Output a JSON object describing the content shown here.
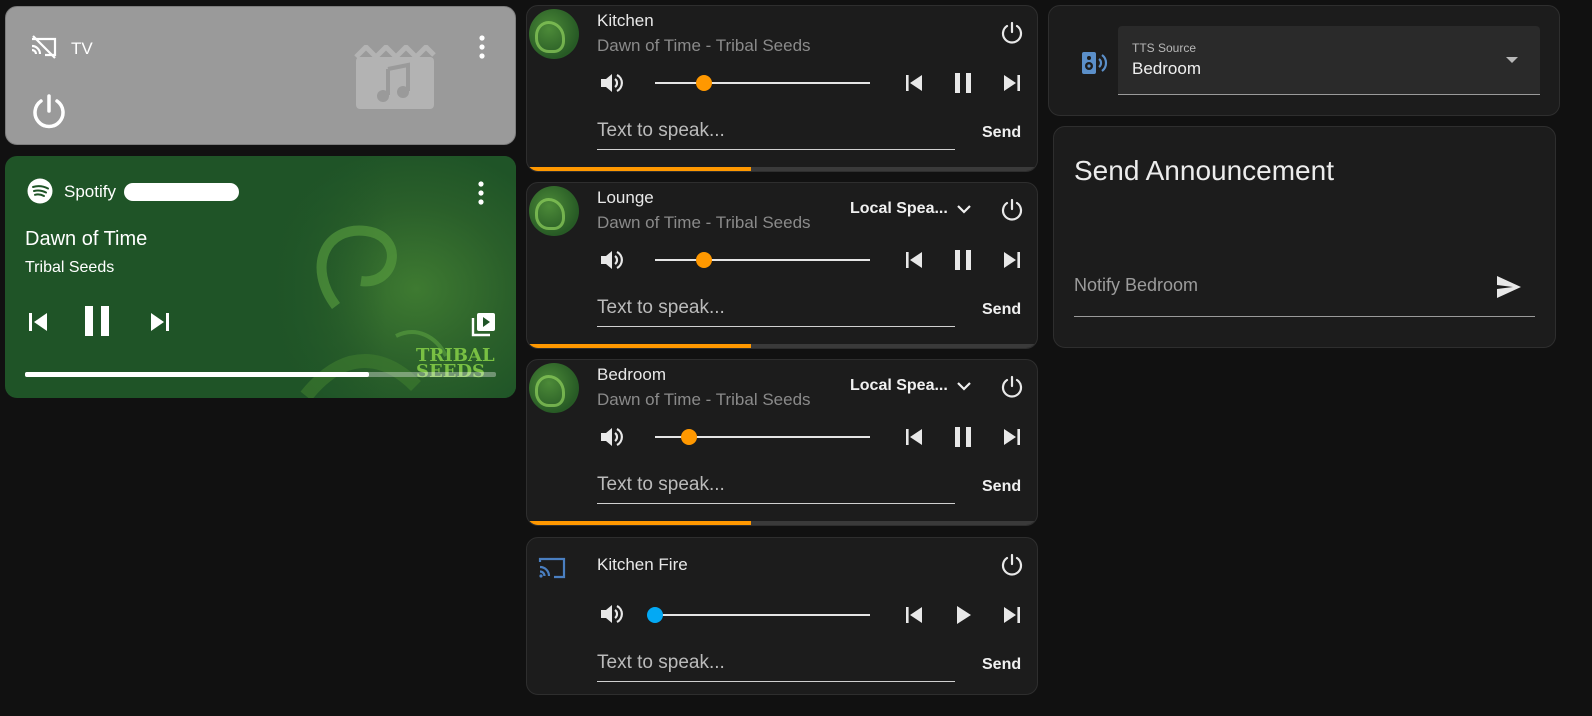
{
  "tv": {
    "name": "TV",
    "state": "off"
  },
  "spotify": {
    "source": "Spotify",
    "track_title": "Dawn of Time",
    "artist": "Tribal Seeds",
    "progress": 0.73,
    "album_logo_text": "TRIBAL\nSEEDS"
  },
  "speakers": [
    {
      "name": "Kitchen",
      "subtitle": "Dawn of Time - Tribal Seeds",
      "source_select": "",
      "volume": 0.23,
      "state": "playing",
      "tts_placeholder": "Text to speak...",
      "send_label": "Send",
      "progress": 0.44
    },
    {
      "name": "Lounge",
      "subtitle": "Dawn of Time - Tribal Seeds",
      "source_select": "Local Spea...",
      "volume": 0.23,
      "state": "playing",
      "tts_placeholder": "Text to speak...",
      "send_label": "Send",
      "progress": 0.44
    },
    {
      "name": "Bedroom",
      "subtitle": "Dawn of Time - Tribal Seeds",
      "source_select": "Local Spea...",
      "volume": 0.16,
      "state": "playing",
      "tts_placeholder": "Text to speak...",
      "send_label": "Send",
      "progress": 0.44
    },
    {
      "name": "Kitchen Fire",
      "subtitle": "",
      "source_select": "",
      "volume": 0.0,
      "state": "paused",
      "tts_placeholder": "Text to speak...",
      "send_label": "Send"
    }
  ],
  "tts_source": {
    "label": "TTS Source",
    "value": "Bedroom"
  },
  "announcement": {
    "title": "Send Announcement",
    "notify_placeholder": "Notify Bedroom"
  },
  "colors": {
    "accent": "#ff9800",
    "idle_knob": "#03a9f4",
    "spotify_bg": "#1f5427",
    "tv_bg": "#9a9a9a",
    "card_bg": "#1c1c1c",
    "page_bg": "#111111"
  }
}
